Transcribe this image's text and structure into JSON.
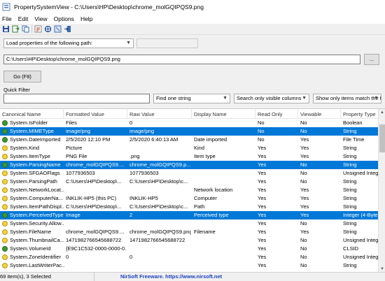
{
  "window": {
    "title": "PropertySystemView  -  C:\\Users\\HP\\Desktop\\chrome_molGQIPQS9.png"
  },
  "menu": [
    "File",
    "Edit",
    "View",
    "Options",
    "Help"
  ],
  "toolbar_icons": [
    "save-icon",
    "export-icon",
    "copy-icon",
    "html-report-icon",
    "search-icon",
    "properties-icon",
    "exit-icon"
  ],
  "load": {
    "mode": "Load properties of the following path:",
    "extra": ""
  },
  "path": {
    "value": "C:\\Users\\HP\\Desktop\\chrome_molGQIPQS9.png",
    "browse": "..."
  },
  "go_label": "Go (F8)",
  "filter": {
    "label": "Quick Filter",
    "value": "",
    "mode": "Find one string",
    "columns": "Search only visible columns",
    "match": "Show only items match the f"
  },
  "columns": [
    "Canonical Name",
    "Formatted Value",
    "Raw Value",
    "Display Name",
    "Read Only",
    "Viewable",
    "Property Type"
  ],
  "colors": {
    "selection": "#0078d7",
    "green": "#3c9a2f",
    "yellow": "#f3d23a"
  },
  "rows": [
    {
      "c": [
        "System.IsFolder",
        "Files",
        "0",
        "",
        "No",
        "No",
        "Boolean"
      ],
      "icon": "green",
      "sel": false
    },
    {
      "c": [
        "System.MIMEType",
        "image/png",
        "image/png",
        "",
        "No",
        "No",
        "String"
      ],
      "icon": "green",
      "sel": true
    },
    {
      "c": [
        "System.DateImported",
        "2/5/2020 12:10 PM",
        "2/5/2020 6:40:13 AM",
        "Date imported",
        "No",
        "Yes",
        "File Time"
      ],
      "icon": "green",
      "sel": false
    },
    {
      "c": [
        "System.Kind",
        "Picture",
        "",
        "Kind",
        "Yes",
        "Yes",
        "String"
      ],
      "icon": "yellow",
      "sel": false
    },
    {
      "c": [
        "System.ItemType",
        "PNG File",
        ".png",
        "Item type",
        "Yes",
        "Yes",
        "String"
      ],
      "icon": "yellow",
      "sel": false
    },
    {
      "c": [
        "System.ParsingName",
        "chrome_molGQIPQS9....",
        "chrome_molGQIPQS9.p...",
        "",
        "Yes",
        "No",
        "String"
      ],
      "icon": "green",
      "sel": true
    },
    {
      "c": [
        "System.SFGAOFlags",
        "1077936503",
        "1077936503",
        "",
        "Yes",
        "No",
        "Unsigned Intege"
      ],
      "icon": "yellow",
      "sel": false
    },
    {
      "c": [
        "System.ParsingPath",
        "C:\\Users\\HP\\Desktop\\...",
        "C:\\Users\\HP\\Desktop\\c...",
        "",
        "Yes",
        "No",
        "String"
      ],
      "icon": "yellow",
      "sel": false
    },
    {
      "c": [
        "System.NetworkLocat...",
        "",
        "",
        "Network location",
        "Yes",
        "Yes",
        "String"
      ],
      "icon": "yellow",
      "sel": false
    },
    {
      "c": [
        "System.ComputerNa...",
        "INKLIK-HP5 (this PC)",
        "INKLIK-HP5",
        "Computer",
        "Yes",
        "Yes",
        "String"
      ],
      "icon": "yellow",
      "sel": false
    },
    {
      "c": [
        "System.ItemPathDispl...",
        "C:\\Users\\HP\\Desktop\\...",
        "C:\\Users\\HP\\Desktop\\c...",
        "Path",
        "Yes",
        "Yes",
        "String"
      ],
      "icon": "yellow",
      "sel": false
    },
    {
      "c": [
        "System.PerceivedType",
        "Image",
        "2",
        "Perceived type",
        "Yes",
        "Yes",
        "Integer (4-Byte)"
      ],
      "icon": "green",
      "sel": true
    },
    {
      "c": [
        "System.Security.Allow...",
        "",
        "",
        "",
        "Yes",
        "No",
        "String"
      ],
      "icon": "yellow",
      "sel": false
    },
    {
      "c": [
        "System.FileName",
        "chrome_molGQIPQS9....",
        "chrome_molGQIPQS9.png",
        "Filename",
        "Yes",
        "Yes",
        "String"
      ],
      "icon": "yellow",
      "sel": false
    },
    {
      "c": [
        "System.ThumbnailCa...",
        "14719827665456887​22",
        "14719827665456887​22",
        "",
        "Yes",
        "No",
        "Unsigned Intege"
      ],
      "icon": "yellow",
      "sel": false
    },
    {
      "c": [
        "System.VolumeId",
        "{E9C1C532-0000-0000-0...",
        "",
        "",
        "Yes",
        "No",
        "CLSID"
      ],
      "icon": "green",
      "sel": false
    },
    {
      "c": [
        "System.ZoneIdentifier",
        "0",
        "0",
        "",
        "Yes",
        "No",
        "Unsigned Intege"
      ],
      "icon": "yellow",
      "sel": false
    },
    {
      "c": [
        "System.LastWriterPac...",
        "",
        "",
        "",
        "Yes",
        "No",
        "String"
      ],
      "icon": "yellow",
      "sel": false
    }
  ],
  "status": {
    "count": "69 item(s), 3 Selected",
    "credit": "NirSoft Freeware. https://www.nirsoft.net"
  }
}
